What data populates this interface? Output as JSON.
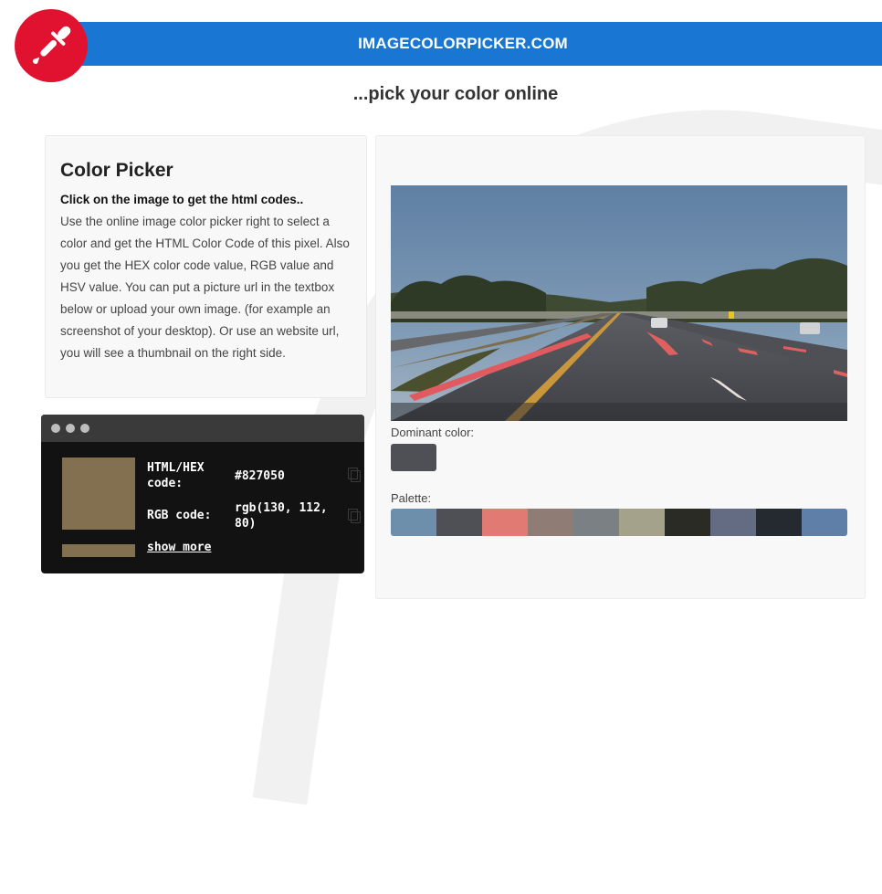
{
  "header": {
    "title": "IMAGECOLORPICKER.COM",
    "tagline": "...pick your color online"
  },
  "intro": {
    "heading": "Color Picker",
    "lead": "Click on the image to get the html codes..",
    "description": "Use the online image color picker right to select a color and get the HTML Color Code of this pixel. Also you get the HEX color code value, RGB value and HSV value. You can put a picture url in the textbox below or upload your own image. (for example an screenshot of your desktop). Or use an website url, you will see a thumbnail on the right side."
  },
  "result": {
    "color": "#827050",
    "hex_label": "HTML/HEX code:",
    "hex_value": "#827050",
    "rgb_label": "RGB code:",
    "rgb_value": "rgb(130, 112, 80)",
    "show_more": "show more"
  },
  "image_panel": {
    "dominant_label": "Dominant color:",
    "dominant_color": "#4e5056",
    "palette_label": "Palette:",
    "palette": [
      "#6e8fac",
      "#4e5056",
      "#e07a73",
      "#8e7c75",
      "#7a8084",
      "#a4a28b",
      "#2a2b25",
      "#636c82",
      "#252a31",
      "#5f7fa9"
    ]
  },
  "colors": {
    "brand_red": "#e1122f",
    "brand_blue": "#1976d2"
  }
}
